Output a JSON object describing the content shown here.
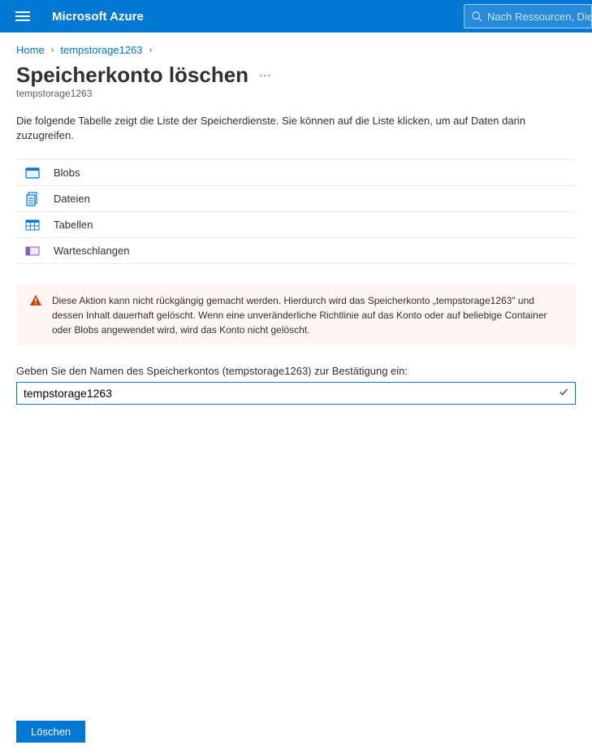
{
  "topbar": {
    "brand": "Microsoft Azure",
    "search_placeholder": "Nach Ressourcen, Diens"
  },
  "breadcrumb": {
    "home": "Home",
    "item": "tempstorage1263"
  },
  "page": {
    "title": "Speicherkonto löschen",
    "subtitle": "tempstorage1263",
    "more": "…"
  },
  "intro": "Die folgende Tabelle zeigt die Liste der Speicherdienste. Sie können auf die Liste klicken, um auf Daten darin zuzugreifen.",
  "services": {
    "blobs": "Blobs",
    "files": "Dateien",
    "tables": "Tabellen",
    "queues": "Warteschlangen"
  },
  "warning": {
    "text": "Diese Aktion kann nicht rückgängig gemacht werden. Hierdurch wird das Speicherkonto „tempstorage1263\" und dessen Inhalt dauerhaft gelöscht. Wenn eine unveränderliche Richtlinie auf das Konto oder auf beliebige Container oder Blobs angewendet wird, wird das Konto nicht gelöscht."
  },
  "confirm": {
    "label": "Geben Sie den Namen des Speicherkontos (tempstorage1263) zur Bestätigung ein:",
    "value": "tempstorage1263"
  },
  "footer": {
    "delete_label": "Löschen"
  }
}
